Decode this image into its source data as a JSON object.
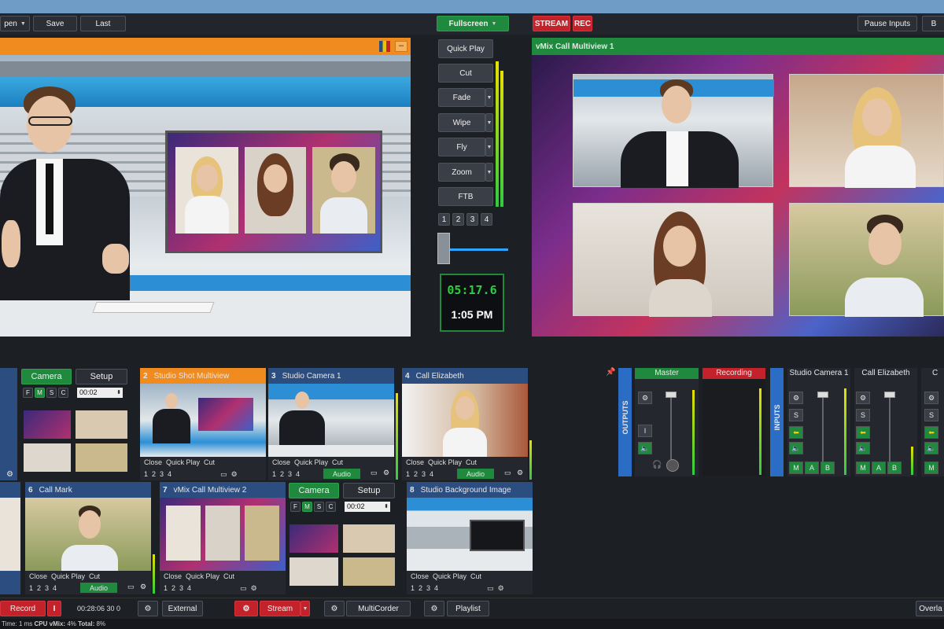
{
  "top_bar": {
    "open_label": "pen",
    "save_label": "Save",
    "last_label": "Last",
    "fullscreen_label": "Fullscreen",
    "stream_label": "STREAM",
    "rec_label": "REC",
    "pause_inputs_label": "Pause Inputs",
    "cut_right_label": "B"
  },
  "transitions": {
    "quick_play": "Quick Play",
    "cut": "Cut",
    "fade": "Fade",
    "wipe": "Wipe",
    "fly": "Fly",
    "zoom": "Zoom",
    "ftb": "FTB",
    "numbers": [
      "1",
      "2",
      "3",
      "4"
    ],
    "timer": "05:17.6",
    "clock": "1:05 PM"
  },
  "output": {
    "title": "vMix Call Multiview 1"
  },
  "multiview_panel": {
    "camera_label": "Camera",
    "setup_label": "Setup",
    "layers": [
      "F",
      "M",
      "S",
      "C"
    ],
    "time_value": "00:02"
  },
  "multiview_panel_2": {
    "camera_label": "Camera",
    "setup_label": "Setup",
    "layers": [
      "F",
      "M",
      "S",
      "C"
    ],
    "time_value": "00:02"
  },
  "inputs": [
    {
      "num": "2",
      "title": "Studio Shot Multiview",
      "close": "Close",
      "quick_play": "Quick Play",
      "cut": "Cut",
      "audio": ""
    },
    {
      "num": "3",
      "title": "Studio Camera 1",
      "close": "Close",
      "quick_play": "Quick Play",
      "cut": "Cut",
      "audio": "Audio"
    },
    {
      "num": "4",
      "title": "Call Elizabeth",
      "close": "Close",
      "quick_play": "Quick Play",
      "cut": "Cut",
      "audio": "Audio"
    },
    {
      "num": "6",
      "title": "Call Mark",
      "close": "Close",
      "quick_play": "Quick Play",
      "cut": "Cut",
      "audio": "Audio"
    },
    {
      "num": "7",
      "title": "vMix Call Multiview 2",
      "close": "Close",
      "quick_play": "Quick Play",
      "cut": "Cut",
      "audio": ""
    },
    {
      "num": "8",
      "title": "Studio Background Image",
      "close": "Close",
      "quick_play": "Quick Play",
      "cut": "Cut",
      "audio": ""
    }
  ],
  "overlay_numbers": [
    "1",
    "2",
    "3",
    "4"
  ],
  "mixer": {
    "outputs_label": "OUTPUTS",
    "inputs_label": "INPUTS",
    "master_label": "Master",
    "recording_label": "Recording",
    "channel_1": "Studio Camera 1",
    "channel_2": "Call Elizabeth",
    "channel_3": "C",
    "s_label": "S",
    "m_label": "M",
    "a_label": "A",
    "b_label": "B",
    "i_label": "I"
  },
  "bottom_bar": {
    "record_label": "Record",
    "record_i": "I",
    "record_time": "00:28:06 30 0",
    "external_label": "External",
    "stream_label": "Stream",
    "multicorder_label": "MultiCorder",
    "playlist_label": "Playlist",
    "overlay_label": "Overla"
  },
  "status_bar": {
    "text_prefix": "Time:",
    "time_value": "1 ms",
    "cpu_label": "CPU vMix:",
    "cpu_value": "4%",
    "total_label": "Total:",
    "total_value": "8%"
  },
  "colors": {
    "accent_orange": "#f08c1f",
    "accent_green": "#1f8a3e",
    "accent_red": "#c4222b",
    "accent_blue": "#2b4d80",
    "timer_green": "#2ecc40"
  }
}
